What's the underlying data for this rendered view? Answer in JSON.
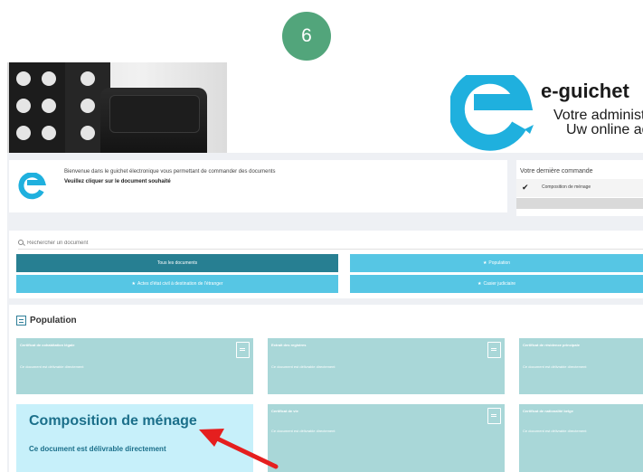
{
  "step_badge": "6",
  "banner": {
    "brand_name": "e-guichet",
    "tagline_1": "Votre administr",
    "tagline_2": "Uw online ad"
  },
  "welcome": {
    "line1": "Bienvenue dans le guichet électronique vous permettant de commander des documents",
    "line2": "Veuillez cliquer sur le document souhaité"
  },
  "last_order": {
    "title": "Votre dernière commande",
    "item": "Composition de ménage"
  },
  "search": {
    "placeholder": "Rechercher un document"
  },
  "filters": {
    "all": "Tous les documents",
    "population": "Population",
    "etranger": "Actes d'état civil à destination de l'étranger",
    "judiciaire": "Casier judiciaire"
  },
  "population": {
    "title": "Population",
    "cards": [
      {
        "title": "Certificat de cohabitation légale",
        "subtitle": "Ce document est délivrable directement"
      },
      {
        "title": "Extrait des registres",
        "subtitle": "Ce document est délivrable directement"
      },
      {
        "title": "Certificat de résidence principale",
        "subtitle": "Ce document est délivrable directement"
      },
      {
        "title": "Composition de ménage",
        "subtitle": "Ce document est délivrable directement"
      },
      {
        "title": "Certificat de vie",
        "subtitle": "Ce document est délivrable directement"
      },
      {
        "title": "Certificat de nationalité belge",
        "subtitle": "Ce document est délivrable directement"
      }
    ]
  },
  "colors": {
    "badge": "#52a57b",
    "filter_active": "#277f92",
    "filter_inactive": "#56c6e4",
    "card": "#a9d7d8",
    "card_highlight": "#c7f0fa",
    "arrow": "#e51f1f",
    "logo": "#1fb0de"
  },
  "icons": [
    "search-icon",
    "check-icon",
    "star-icon",
    "document-icon",
    "section-list-icon",
    "pointer-arrow-icon"
  ]
}
